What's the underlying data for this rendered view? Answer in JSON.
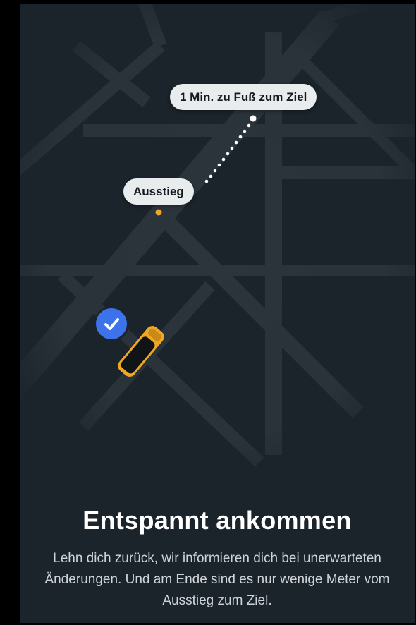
{
  "map": {
    "destination_label": "1 Min. zu Fuß zum Ziel",
    "dropoff_label": "Ausstieg",
    "icons": {
      "check": "check-icon",
      "car": "taxi-car-icon",
      "dropoff_marker": "dropoff-dot-icon",
      "destination_marker": "destination-dot-icon"
    },
    "colors": {
      "background": "#1b232b",
      "road": "#2d353d",
      "bubble": "#e9eced",
      "car": "#f0a824",
      "badge": "#3c73ea"
    }
  },
  "content": {
    "title": "Entspannt ankommen",
    "description": "Lehn dich zurück, wir informieren dich bei unerwarteten Änderungen. Und am Ende sind es nur wenige Meter vom Ausstieg zum Ziel."
  }
}
